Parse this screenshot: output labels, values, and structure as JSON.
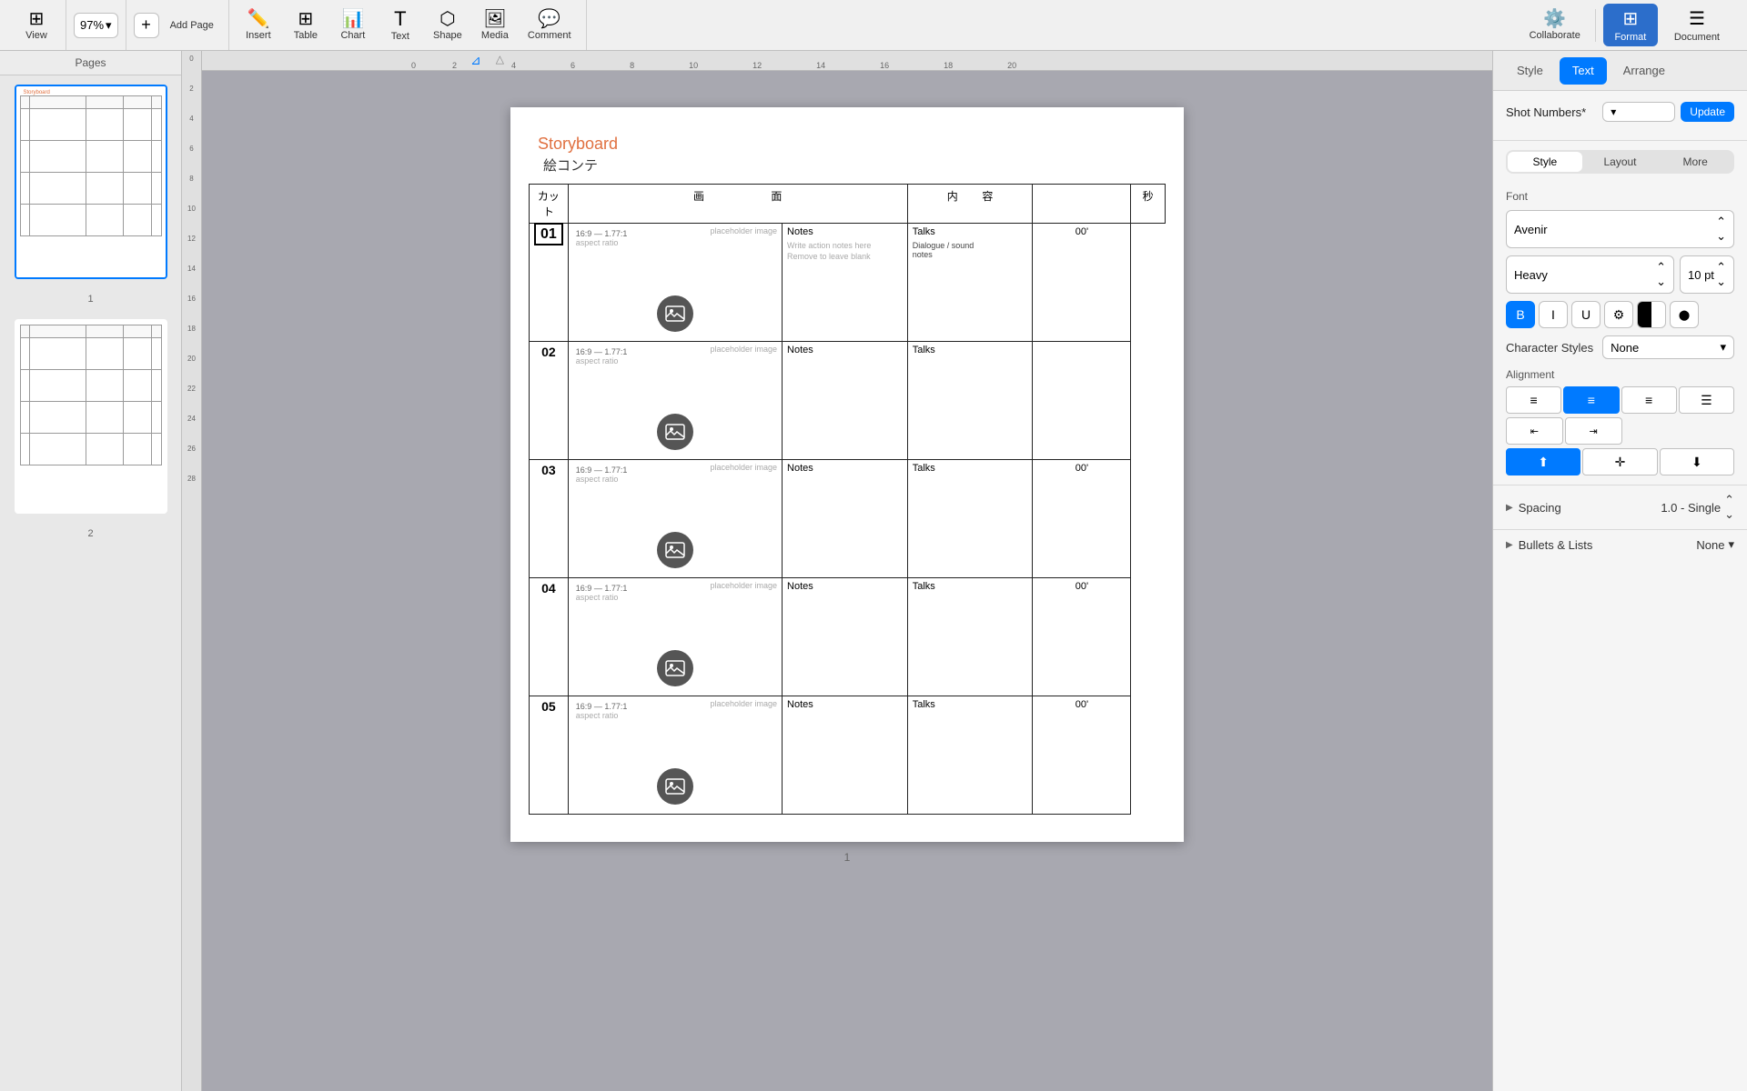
{
  "toolbar": {
    "view_label": "View",
    "zoom_value": "97%",
    "add_page_label": "Add Page",
    "insert_label": "Insert",
    "table_label": "Table",
    "chart_label": "Chart",
    "text_label": "Text",
    "shape_label": "Shape",
    "media_label": "Media",
    "comment_label": "Comment",
    "collaborate_label": "Collaborate",
    "format_label": "Format",
    "document_label": "Document"
  },
  "pages_panel": {
    "header": "Pages",
    "page1_num": "1",
    "page2_num": "2"
  },
  "canvas": {
    "page_number": "1",
    "title": "Storyboard",
    "subtitle": "絵コンテ",
    "table": {
      "headers": [
        "カット",
        "画",
        "面",
        "内",
        "容",
        "秒"
      ],
      "rows": [
        {
          "num": "01",
          "aspect": "16:9 — 1.77:1",
          "aspect_sub": "aspect ratio",
          "placeholder": "placeholder image",
          "notes": "Notes",
          "notes_hint1": "Write action notes here",
          "notes_hint2": "Remove to leave blank",
          "talks": "Talks",
          "talks_sub": "Dialogue / sound\nnotes",
          "sec": "00'"
        },
        {
          "num": "02",
          "aspect": "16:9 — 1.77:1",
          "aspect_sub": "aspect ratio",
          "placeholder": "placeholder image",
          "notes": "Notes",
          "talks": "Talks",
          "sec": ""
        },
        {
          "num": "03",
          "aspect": "16:9 — 1.77:1",
          "aspect_sub": "aspect ratio",
          "placeholder": "placeholder image",
          "notes": "Notes",
          "talks": "Talks",
          "sec": "00'"
        },
        {
          "num": "04",
          "aspect": "16:9 — 1.77:1",
          "aspect_sub": "aspect ratio",
          "placeholder": "placeholder image",
          "notes": "Notes",
          "talks": "Talks",
          "sec": "00'"
        },
        {
          "num": "05",
          "aspect": "16:9 — 1.77:1",
          "aspect_sub": "aspect ratio",
          "placeholder": "placeholder image",
          "notes": "Notes",
          "talks": "Talks",
          "sec": "00'"
        }
      ]
    }
  },
  "right_panel": {
    "tab_style": "Style",
    "tab_text": "Text",
    "tab_arrange": "Arrange",
    "shot_numbers_label": "Shot Numbers*",
    "update_label": "Update",
    "inner_tab_style": "Style",
    "inner_tab_layout": "Layout",
    "inner_tab_more": "More",
    "font_section": "Font",
    "font_name": "Avenir",
    "font_weight": "Heavy",
    "font_size": "10 pt",
    "bold_label": "B",
    "italic_label": "I",
    "underline_label": "U",
    "char_styles_label": "Character Styles",
    "char_styles_value": "None",
    "alignment_label": "Alignment",
    "spacing_label": "Spacing",
    "spacing_value": "1.0 - Single",
    "bullets_label": "Bullets & Lists",
    "bullets_value": "None"
  }
}
